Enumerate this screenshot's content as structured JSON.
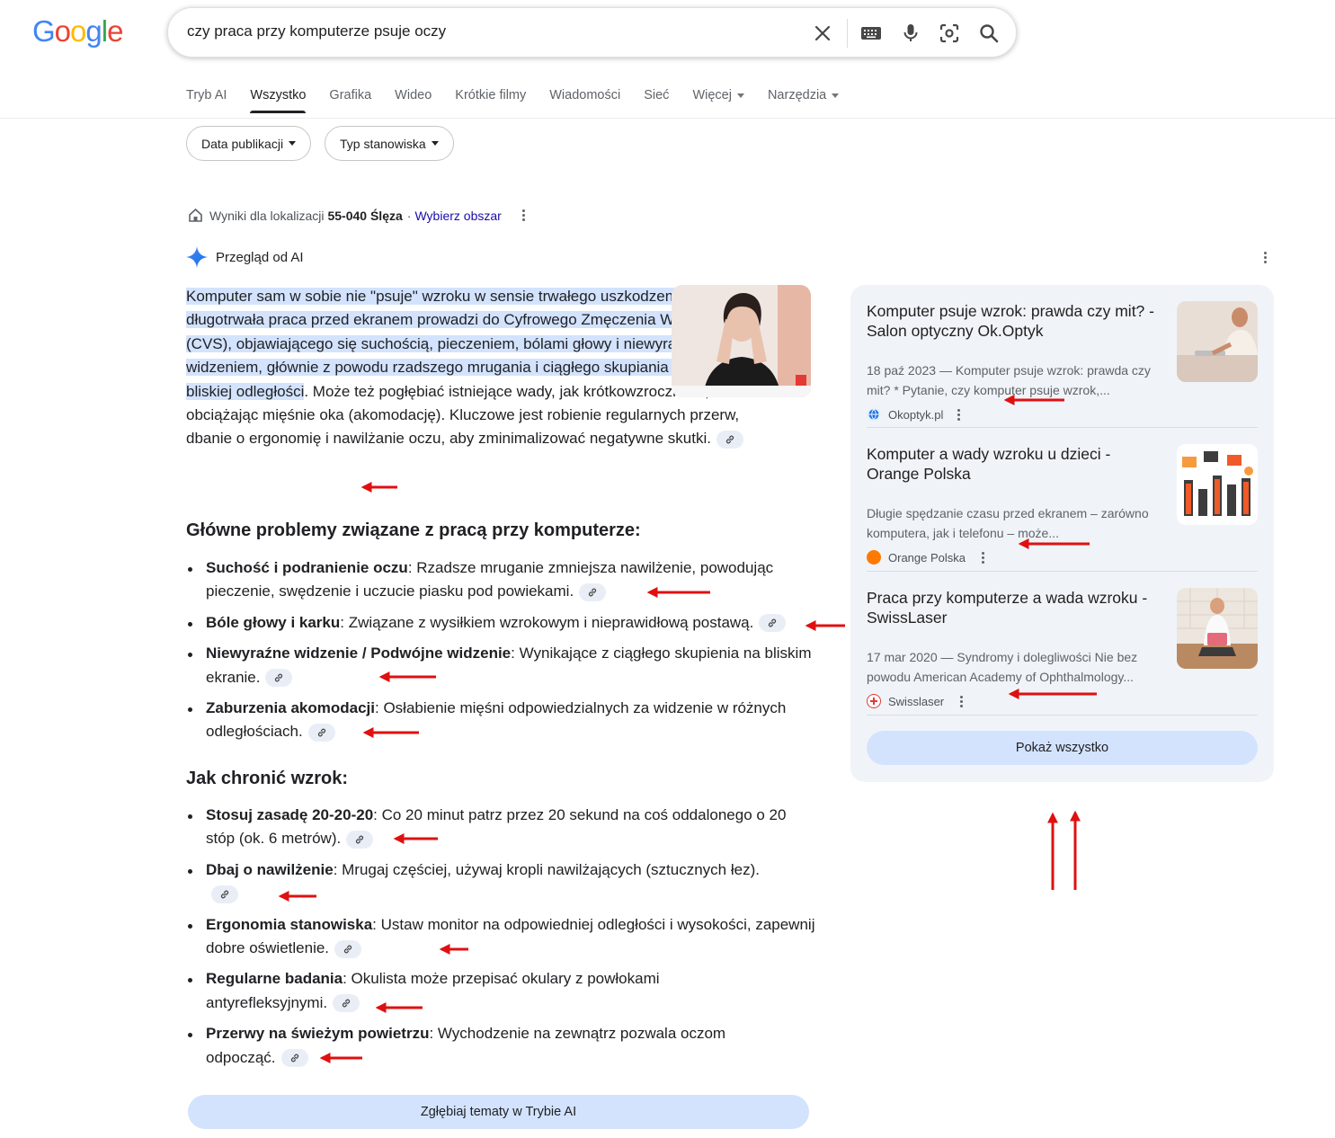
{
  "logo": [
    "G",
    "o",
    "o",
    "g",
    "l",
    "e"
  ],
  "search": {
    "query": "czy praca przy komputerze psuje oczy"
  },
  "tabs": [
    "Tryb AI",
    "Wszystko",
    "Grafika",
    "Wideo",
    "Krótkie filmy",
    "Wiadomości",
    "Sieć",
    "Więcej",
    "Narzędzia"
  ],
  "filters": [
    "Data publikacji",
    "Typ stanowiska"
  ],
  "location": {
    "prefix": "Wyniki dla lokalizacji",
    "place": "55-040 Ślęza",
    "separator": "·",
    "link": "Wybierz obszar"
  },
  "ai": {
    "header": "Przegląd od AI",
    "intro_highlight": "Komputer sam w sobie nie \"psuje\" wzroku w sensie trwałego uszkodzenia, ale długotrwała praca przed ekranem prowadzi do Cyfrowego Zmęczenia Wzroku (CVS), objawiającego się suchością, pieczeniem, bólami głowy i niewyraźnym widzeniem, głównie z powodu rzadszego mrugania i ciągłego skupiania wzroku na bliskiej odległości",
    "intro_rest": ". Może też pogłębiać istniejące wady, jak krótkowzroczność, obciążając mięśnie oka (akomodację). Kluczowe jest robienie regularnych przerw, dbanie o ergonomię i nawilżanie oczu, aby zminimalizować negatywne skutki.",
    "heading1": "Główne problemy związane z pracą przy komputerze:",
    "problems": [
      {
        "bold": "Suchość i podranienie oczu",
        "text": ": Rzadsze mruganie zmniejsza nawilżenie, powodując pieczenie, swędzenie i uczucie piasku pod powiekami."
      },
      {
        "bold": "Bóle głowy i karku",
        "text": ": Związane z wysiłkiem wzrokowym i nieprawidłową postawą."
      },
      {
        "bold": "Niewyraźne widzenie / Podwójne widzenie",
        "text": ": Wynikające z ciągłego skupienia na bliskim ekranie."
      },
      {
        "bold": "Zaburzenia akomodacji",
        "text": ": Osłabienie mięśni odpowiedzialnych za widzenie w różnych odległościach."
      }
    ],
    "heading2": "Jak chronić wzrok:",
    "tips": [
      {
        "bold": "Stosuj zasadę 20-20-20",
        "text": ": Co 20 minut patrz przez 20 sekund na coś oddalonego o 20 stóp (ok. 6 metrów)."
      },
      {
        "bold": "Dbaj o nawilżenie",
        "text": ": Mrugaj częściej, używaj kropli nawilżających (sztucznych łez)."
      },
      {
        "bold": "Ergonomia stanowiska",
        "text": ": Ustaw monitor na odpowiedniej odległości i wysokości, zapewnij dobre oświetlenie."
      },
      {
        "bold": "Regularne badania",
        "text": ": Okulista może przepisać okulary z powłokami antyrefleksyjnymi."
      },
      {
        "bold": "Przerwy na świeżym powietrzu",
        "text": ": Wychodzenie na zewnątrz pozwala oczom odpocząć."
      }
    ],
    "explore_button": "Zgłębiaj tematy w Trybie AI"
  },
  "sources": [
    {
      "title": "Komputer psuje wzrok: prawda czy mit? - Salon optyczny Ok.Optyk",
      "snippet": "18 paź 2023 — Komputer psuje wzrok: prawda czy mit? * Pytanie, czy komputer psuje wzrok,...",
      "site": "Okoptyk.pl"
    },
    {
      "title": "Komputer a wady wzroku u dzieci - Orange Polska",
      "snippet": "Długie spędzanie czasu przed ekranem – zarówno komputera, jak i telefonu – może...",
      "site": "Orange Polska"
    },
    {
      "title": "Praca przy komputerze a wada wzroku - SwissLaser",
      "snippet": "17 mar 2020 — Syndromy i dolegliwości Nie bez powodu American Academy of Ophthalmology...",
      "site": "Swisslaser"
    }
  ],
  "show_all": "Pokaż wszystko",
  "colors": {
    "accent": "#1a0dab",
    "highlight": "#d3e3fd",
    "panel": "#f0f4f9",
    "annotation": "#e01010"
  },
  "icons": [
    "clear-icon",
    "keyboard-icon",
    "microphone-icon",
    "lens-icon",
    "search-icon",
    "home-icon",
    "ai-sparkle-icon",
    "link-icon",
    "more-vert-icon"
  ]
}
